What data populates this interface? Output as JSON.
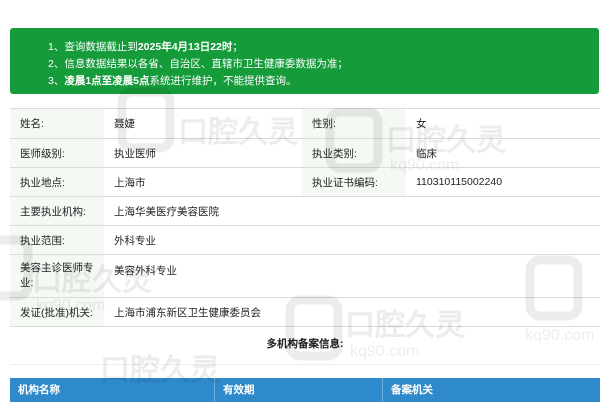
{
  "notice": {
    "lines": [
      {
        "prefix": "1、查询数据截止到",
        "bold": "2025年4月13日22时",
        "suffix": "；"
      },
      {
        "prefix": "2、信息数据结果以各省、自治区、直辖市卫生健康委数据为准；",
        "bold": "",
        "suffix": ""
      },
      {
        "prefix": "3、",
        "bold": "凌晨1点至凌晨5点",
        "suffix": "系统进行维护，不能提供查询。"
      }
    ]
  },
  "info": {
    "name_label": "姓名:",
    "name": "聂婕",
    "gender_label": "性别:",
    "gender": "女",
    "level_label": "医师级别:",
    "level": "执业医师",
    "category_label": "执业类别:",
    "category": "临床",
    "location_label": "执业地点:",
    "location": "上海市",
    "cert_label": "执业证书编码:",
    "cert": "110310115002240",
    "org_label": "主要执业机构:",
    "org": "上海华美医疗美容医院",
    "scope_label": "执业范围:",
    "scope": "外科专业",
    "cosmetic_label": "美容主诊医师专业:",
    "cosmetic": "美容外科专业",
    "issuer_label": "发证(批准)机关:",
    "issuer": "上海市浦东新区卫生健康委员会"
  },
  "multi": {
    "title": "多机构备案信息:",
    "headers": [
      "机构名称",
      "有效期",
      "备案机关"
    ]
  },
  "watermark": {
    "text": "口腔久灵",
    "sub": "kq90.com"
  },
  "colors": {
    "notice_bg": "#169b3b",
    "table_header": "#2f8acb",
    "label_bg": "#f4f9f4"
  }
}
